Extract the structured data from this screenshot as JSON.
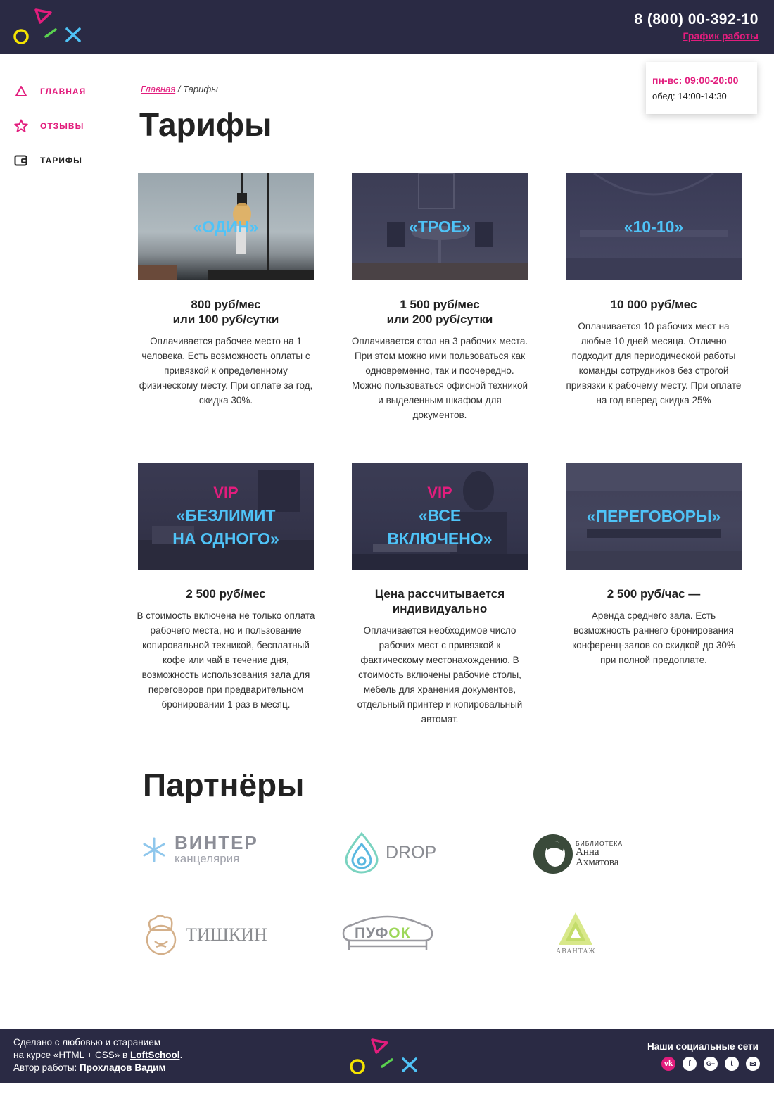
{
  "header": {
    "phone": "8 (800) 00-392-10",
    "schedule_link": "График работы"
  },
  "schedule_popup": {
    "hours": "пн-вс: 09:00-20:00",
    "lunch": "обед: 14:00-14:30"
  },
  "sidebar": {
    "items": [
      {
        "label": "ГЛАВНАЯ",
        "icon": "triangle-icon"
      },
      {
        "label": "ОТЗЫВЫ",
        "icon": "star-icon"
      },
      {
        "label": "ТАРИФЫ",
        "icon": "wallet-icon"
      }
    ]
  },
  "breadcrumb": {
    "home": "Главная",
    "separator": " / ",
    "current": "Тарифы"
  },
  "page_title": "Тарифы",
  "tariffs": [
    {
      "vip": "",
      "name": "«ОДИН»",
      "price": "800 руб/мес\nили 100 руб/сутки",
      "description": "Оплачивается рабочее место на 1 человека. Есть возможность оплаты с привязкой к определенному физическому месту. При оплате за год, скидка 30%."
    },
    {
      "vip": "",
      "name": "«ТРОЕ»",
      "price": "1 500 руб/мес\nили 200 руб/сутки",
      "description": "Оплачивается стол на 3 рабочих места. При этом можно ими пользоваться как одновременно, так и поочередно. Можно пользоваться офисной техникой и выделенным шкафом для документов."
    },
    {
      "vip": "",
      "name": "«10-10»",
      "price": "10 000 руб/мес",
      "description": "Оплачивается 10 рабочих мест на любые 10 дней месяца. Отлично подходит для периодической работы команды сотрудников без строгой привязки к рабочему месту. При оплате на год вперед скидка 25%"
    },
    {
      "vip": "VIP",
      "name": "«БЕЗЛИМИТ\nНА ОДНОГО»",
      "price": "2 500 руб/мес",
      "description": "В стоимость включена не только оплата рабочего места, но и пользование копировальной техникой, бесплатный кофе или чай в течение дня, возможность использования зала для переговоров при предварительном бронировании 1 раз в месяц."
    },
    {
      "vip": "VIP",
      "name": "«ВСЕ\nВКЛЮЧЕНО»",
      "price": "Цена рассчитывается\nиндивидуально",
      "description": "Оплачивается необходимое число рабочих мест с привязкой к фактическому местонахождению. В стоимость включены рабочие столы, мебель для хранения документов, отдельный принтер и копировальный автомат."
    },
    {
      "vip": "",
      "name": "«ПЕРЕГОВОРЫ»",
      "price": "2 500 руб/час —",
      "description": "Аренда среднего зала. Есть возможность раннего бронирования конференц-залов со скидкой до 30% при полной предоплате."
    }
  ],
  "partners_title": "Партнёры",
  "partners": {
    "winter": {
      "name": "ВИНТЕР",
      "sub": "канцелярия"
    },
    "drop": {
      "name": "DROP"
    },
    "library": {
      "top": "БИБЛИОТЕКА",
      "line1": "Анна",
      "line2": "Ахматова"
    },
    "tishkin": {
      "name": "ТИШКИН"
    },
    "pufok": {
      "name_a": "ПУФ",
      "name_b": "ОК"
    },
    "avantazh": {
      "name": "АВАНТАЖ"
    }
  },
  "footer": {
    "line1": "Сделано с любовью и старанием",
    "line2_a": "на курсе «HTML + CSS» в ",
    "line2_link": "LoftSchool",
    "line2_b": ".",
    "line3_a": "Автор работы: ",
    "line3_author": "Прохладов Вадим",
    "social_title": "Наши социальные сети",
    "socials": [
      {
        "icon": "vk-icon",
        "glyph": "vk"
      },
      {
        "icon": "facebook-icon",
        "glyph": "f"
      },
      {
        "icon": "google-plus-icon",
        "glyph": "G+"
      },
      {
        "icon": "twitter-icon",
        "glyph": "t"
      },
      {
        "icon": "mail-icon",
        "glyph": "✉"
      }
    ]
  },
  "colors": {
    "dark": "#2a2a44",
    "pink": "#e21d7d",
    "blue": "#4fc3f7",
    "yellow": "#f5e400",
    "green": "#5ad14f"
  }
}
